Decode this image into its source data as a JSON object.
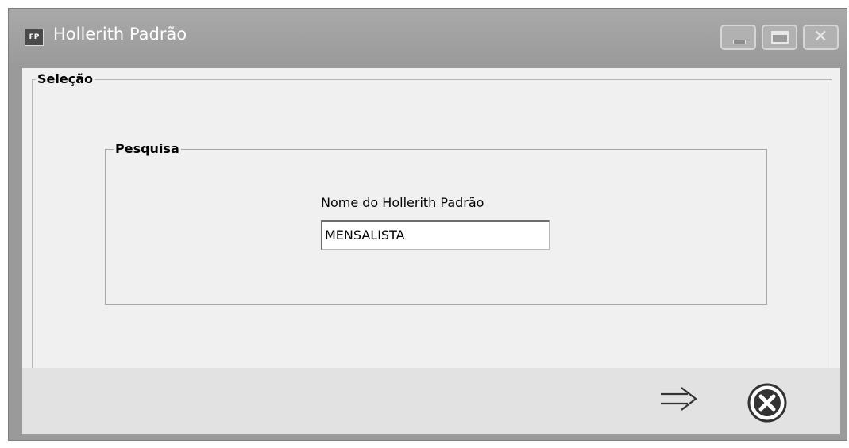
{
  "window": {
    "app_badge": "FP",
    "title": "Hollerith Padrão"
  },
  "selecao": {
    "legend": "Seleção"
  },
  "pesquisa": {
    "legend": "Pesquisa",
    "field_label": "Nome do Hollerith Padrão",
    "field_value": "MENSALISTA"
  },
  "icons": {
    "next": "arrow-right-icon",
    "cancel": "close-circle-icon"
  }
}
